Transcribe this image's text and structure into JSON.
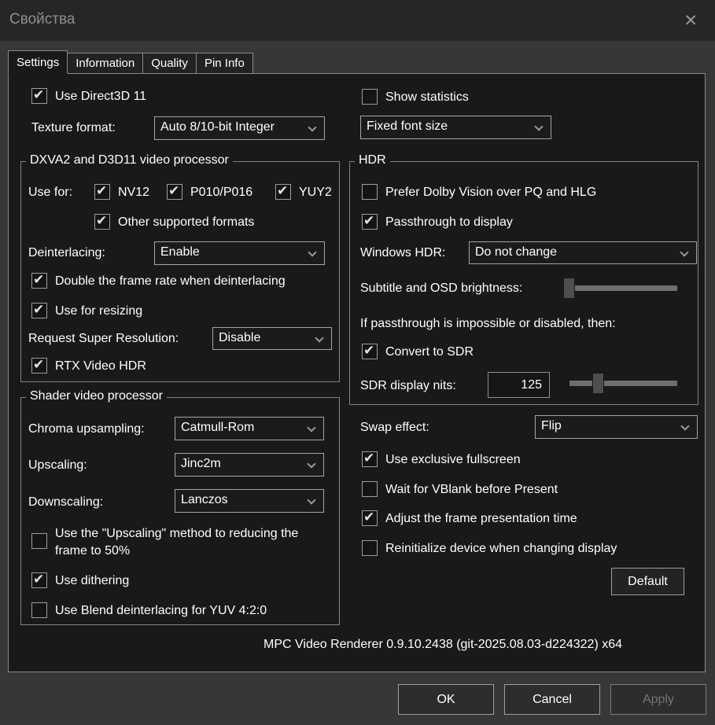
{
  "window": {
    "title": "Свойства",
    "close_icon": "✕"
  },
  "tabs": [
    {
      "label": "Settings",
      "active": true
    },
    {
      "label": "Information",
      "active": false
    },
    {
      "label": "Quality",
      "active": false
    },
    {
      "label": "Pin Info",
      "active": false
    }
  ],
  "colors": {
    "titlebar_bg": "#262626",
    "dialog_bg": "#373737",
    "panel_bg": "#191919",
    "border": "#8a8a8a",
    "text": "#ffffff",
    "disabled_text": "#747474"
  },
  "settings": {
    "use_direct3d11": {
      "label": "Use Direct3D 11",
      "checked": true
    },
    "texture_format": {
      "label": "Texture format:",
      "value": "Auto 8/10-bit Integer"
    },
    "show_statistics": {
      "label": "Show statistics",
      "checked": false
    },
    "statistics_font": {
      "value": "Fixed font size"
    },
    "dxva_group": {
      "title": "DXVA2 and D3D11 video processor",
      "use_for_label": "Use for:",
      "nv12": {
        "label": "NV12",
        "checked": true
      },
      "p010": {
        "label": "P010/P016",
        "checked": true
      },
      "yuy2": {
        "label": "YUY2",
        "checked": true
      },
      "other_formats": {
        "label": "Other supported formats",
        "checked": true
      },
      "deinterlacing": {
        "label": "Deinterlacing:",
        "value": "Enable"
      },
      "double_frame_rate": {
        "label": "Double the frame rate when deinterlacing",
        "checked": true
      },
      "use_for_resizing": {
        "label": "Use for resizing",
        "checked": true
      },
      "super_resolution": {
        "label": "Request Super Resolution:",
        "value": "Disable"
      },
      "rtx_video_hdr": {
        "label": "RTX Video HDR",
        "checked": true
      }
    },
    "shader_group": {
      "title": "Shader video processor",
      "chroma_upsampling": {
        "label": "Chroma upsampling:",
        "value": "Catmull-Rom"
      },
      "upscaling": {
        "label": "Upscaling:",
        "value": "Jinc2m"
      },
      "downscaling": {
        "label": "Downscaling:",
        "value": "Lanczos"
      },
      "upscaling_method_50": {
        "label": "Use the \"Upscaling\" method to reducing the frame to 50%",
        "checked": false
      },
      "use_dithering": {
        "label": "Use dithering",
        "checked": true
      },
      "blend_deinterlacing": {
        "label": "Use Blend deinterlacing for YUV 4:2:0",
        "checked": false
      }
    },
    "hdr_group": {
      "title": "HDR",
      "prefer_dolby_vision": {
        "label": "Prefer Dolby Vision over PQ and HLG",
        "checked": false
      },
      "passthrough_to_display": {
        "label": "Passthrough to display",
        "checked": true
      },
      "windows_hdr": {
        "label": "Windows HDR:",
        "value": "Do not change"
      },
      "osd_brightness": {
        "label": "Subtitle and OSD brightness:",
        "slider_percent": 0
      },
      "fallback_note": "If passthrough is impossible or disabled, then:",
      "convert_to_sdr": {
        "label": "Convert to SDR",
        "checked": true
      },
      "sdr_display_nits": {
        "label": "SDR display nits:",
        "value": "125",
        "slider_percent": 28
      }
    },
    "swap_effect": {
      "label": "Swap effect:",
      "value": "Flip"
    },
    "exclusive_fullscreen": {
      "label": "Use exclusive fullscreen",
      "checked": true
    },
    "wait_vblank": {
      "label": "Wait for VBlank before Present",
      "checked": false
    },
    "adjust_frame_time": {
      "label": "Adjust the frame presentation time",
      "checked": true
    },
    "reinit_device": {
      "label": "Reinitialize device when changing display",
      "checked": false
    },
    "default_button": "Default",
    "version": "MPC Video Renderer 0.9.10.2438 (git-2025.08.03-d224322) x64"
  },
  "footer": {
    "ok": "OK",
    "cancel": "Cancel",
    "apply": "Apply",
    "apply_enabled": false
  }
}
